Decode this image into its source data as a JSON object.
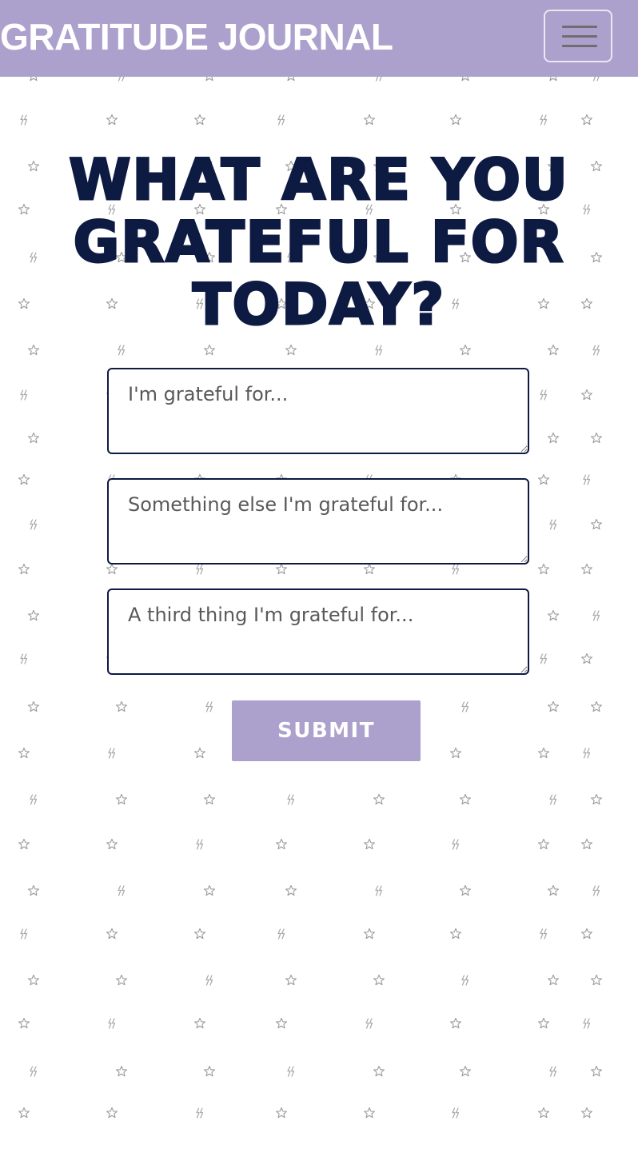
{
  "navbar": {
    "brand": "GRATITUDE JOURNAL",
    "menu_icon": "hamburger-menu-icon",
    "background_color": "#aca1cd"
  },
  "main": {
    "heading": "WHAT ARE YOU GRATEFUL FOR TODAY?",
    "heading_color": "#0d1a42",
    "entries": [
      {
        "placeholder": "I'm grateful for...",
        "value": ""
      },
      {
        "placeholder": "Something else I'm grateful for...",
        "value": ""
      },
      {
        "placeholder": "A third thing I'm grateful for...",
        "value": ""
      }
    ],
    "submit_label": "SUBMIT"
  },
  "background": {
    "pattern_icons": [
      "star-outline-icon",
      "lightning-icon"
    ]
  }
}
